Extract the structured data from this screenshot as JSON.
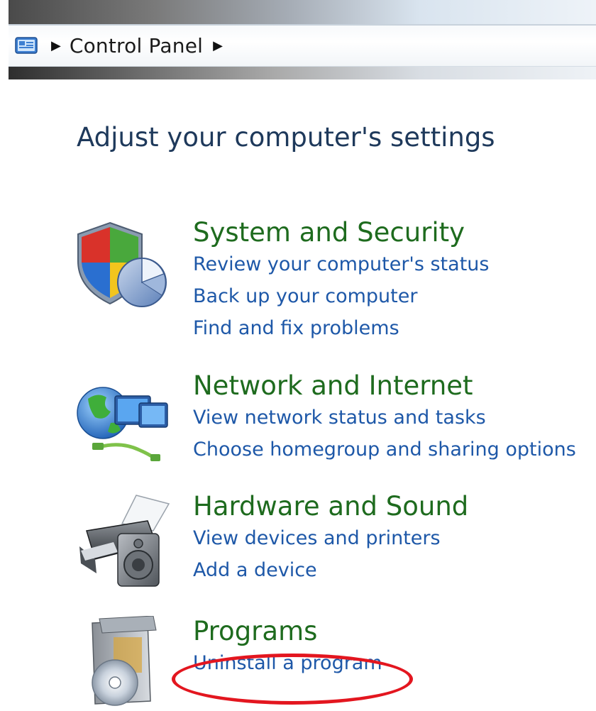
{
  "breadcrumb": {
    "items": [
      "Control Panel"
    ]
  },
  "heading": "Adjust your computer's settings",
  "categories": [
    {
      "title": "System and Security",
      "icon": "shield-chart-icon",
      "links": [
        "Review your computer's status",
        "Back up your computer",
        "Find and fix problems"
      ]
    },
    {
      "title": "Network and Internet",
      "icon": "globe-network-icon",
      "links": [
        "View network status and tasks",
        "Choose homegroup and sharing options"
      ]
    },
    {
      "title": "Hardware and Sound",
      "icon": "printer-speaker-icon",
      "links": [
        "View devices and printers",
        "Add a device"
      ]
    },
    {
      "title": "Programs",
      "icon": "programs-disc-icon",
      "links": [
        "Uninstall a program"
      ]
    }
  ],
  "annotation": {
    "highlight_color": "#e3161f",
    "highlighted_link": "Uninstall a program"
  },
  "colors": {
    "heading": "#1e395b",
    "category_title": "#1e6b1e",
    "link": "#1e58a8"
  }
}
